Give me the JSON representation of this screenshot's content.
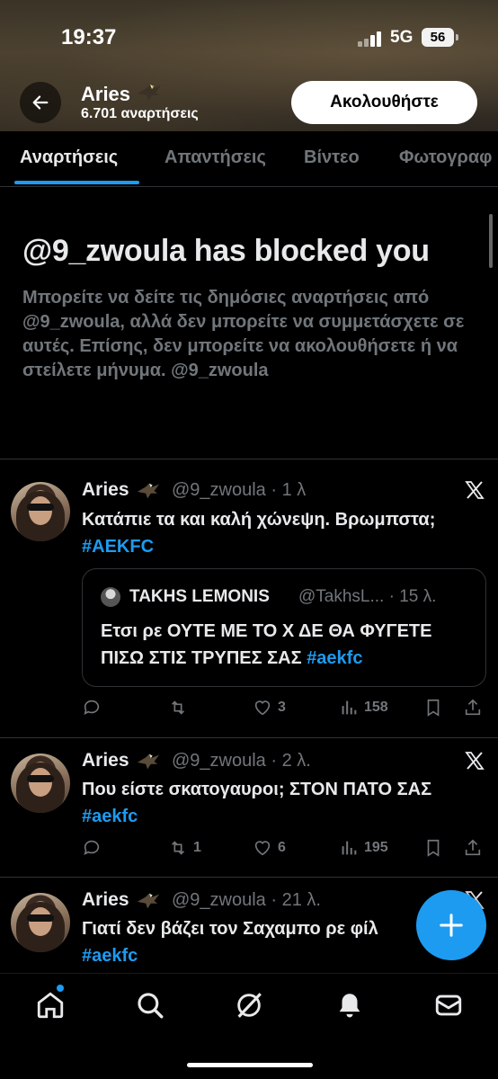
{
  "status_bar": {
    "time": "19:37",
    "network": "5G",
    "battery": "56"
  },
  "profile_header": {
    "name": "Aries",
    "posts_count": "6.701 αναρτήσεις",
    "follow_label": "Ακολουθήστε"
  },
  "tabs": [
    {
      "label": "Αναρτήσεις",
      "active": true
    },
    {
      "label": "Απαντήσεις",
      "active": false
    },
    {
      "label": "Βίντεο",
      "active": false
    },
    {
      "label": "Φωτογραφ",
      "active": false
    }
  ],
  "blocked": {
    "title": "@9_zwoula has blocked you",
    "message": "Μπορείτε να δείτε τις δημόσιες αναρτήσεις από @9_zwoula, αλλά δεν μπορείτε να συμμετάσχετε σε αυτές. Επίσης, δεν μπορείτε να ακολουθήσετε ή να στείλετε μήνυμα. @9_zwoula"
  },
  "posts": [
    {
      "name": "Aries",
      "handle_time": "@9_zwoula · 1 λ",
      "text": "Κατάπιε τα και καλή χώνεψη. Βρωμπστα;",
      "hashtag": "#AEKFC",
      "quote": {
        "name": "TAKHS LEMONIS",
        "handle_time": "@TakhsL... · 15 λ.",
        "text": "Ετσι ρε ΟΥΤΕ ΜΕ ΤΟ Χ ΔΕ ΘΑ ΦΥΓΕΤΕ ΠΙΣΩ ΣΤΙΣ ΤΡΥΠΕΣ ΣΑΣ",
        "hashtag": "#aekfc"
      },
      "replies": "",
      "reposts": "",
      "likes": "3",
      "views": "158"
    },
    {
      "name": "Aries",
      "handle_time": "@9_zwoula · 2 λ.",
      "text": "Που είστε σκατογαυροι; ΣΤΟΝ ΠΑΤΟ ΣΑΣ",
      "hashtag": "#aekfc",
      "replies": "",
      "reposts": "1",
      "likes": "6",
      "views": "195"
    },
    {
      "name": "Aries",
      "handle_time": "@9_zwoula · 21 λ.",
      "text": "Γιατί δεν βάζει τον Σαχαμπο ρε φίλ",
      "hashtag": "#aekfc"
    }
  ],
  "colors": {
    "accent": "#1d9bf0",
    "text": "#e7e9ea",
    "muted": "#71767b",
    "divider": "#2f3336"
  },
  "icons": [
    "back-arrow-icon",
    "eagle-emoji-icon",
    "x-logo-icon",
    "reply-icon",
    "repost-icon",
    "like-icon",
    "views-icon",
    "bookmark-icon",
    "share-icon",
    "compose-plus-icon",
    "home-icon",
    "search-icon",
    "grok-icon",
    "notifications-icon",
    "messages-icon"
  ]
}
